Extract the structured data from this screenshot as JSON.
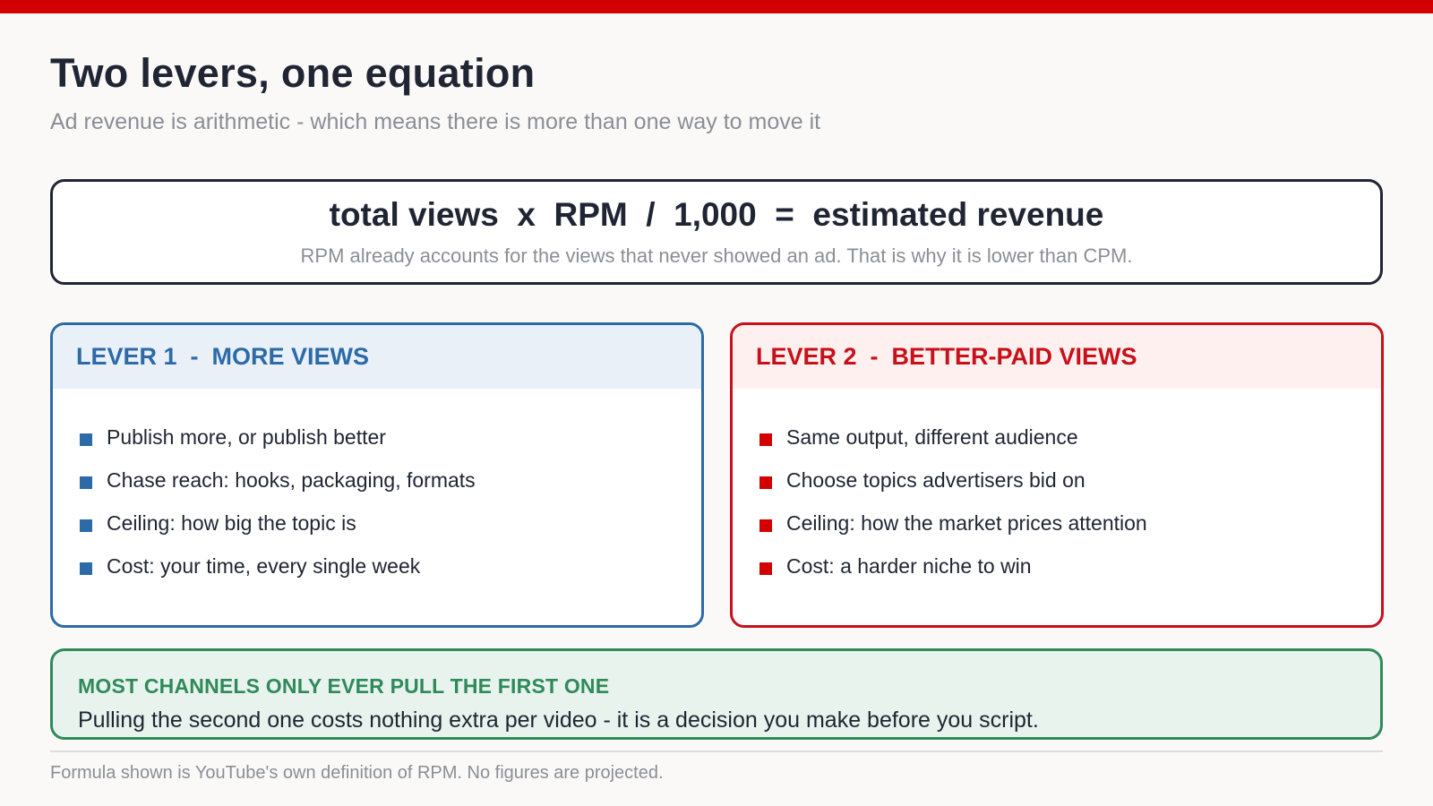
{
  "colors": {
    "accent_red": "#d30000",
    "lever1_blue": "#2c6aa8",
    "lever2_red": "#c8101a",
    "callout_green": "#2f8a5a",
    "ink": "#1f2533",
    "muted": "#8a8e96"
  },
  "header": {
    "title": "Two levers, one equation",
    "subtitle": "Ad revenue is arithmetic - which means there is more than one way to move it"
  },
  "formula": {
    "text": "total views  x  RPM  /  1,000  =  estimated revenue",
    "note": "RPM already accounts for the views that never showed an ad. That is why it is lower than CPM."
  },
  "levers": [
    {
      "heading": "LEVER 1  -  MORE VIEWS",
      "bullet_icon": "square-bullet-icon",
      "items": [
        "Publish more, or publish better",
        "Chase reach: hooks, packaging, formats",
        "Ceiling: how big the topic is",
        "Cost: your time, every single week"
      ]
    },
    {
      "heading": "LEVER 2  -  BETTER-PAID VIEWS",
      "bullet_icon": "square-bullet-icon",
      "items": [
        "Same output, different audience",
        "Choose topics advertisers bid on",
        "Ceiling: how the market prices attention",
        "Cost: a harder niche to win"
      ]
    }
  ],
  "callout": {
    "heading": "MOST CHANNELS ONLY EVER PULL THE FIRST ONE",
    "body": "Pulling the second one costs nothing extra per video - it is a decision you make before you script."
  },
  "footer": {
    "text": "Formula shown is YouTube's own definition of RPM. No figures are projected."
  }
}
